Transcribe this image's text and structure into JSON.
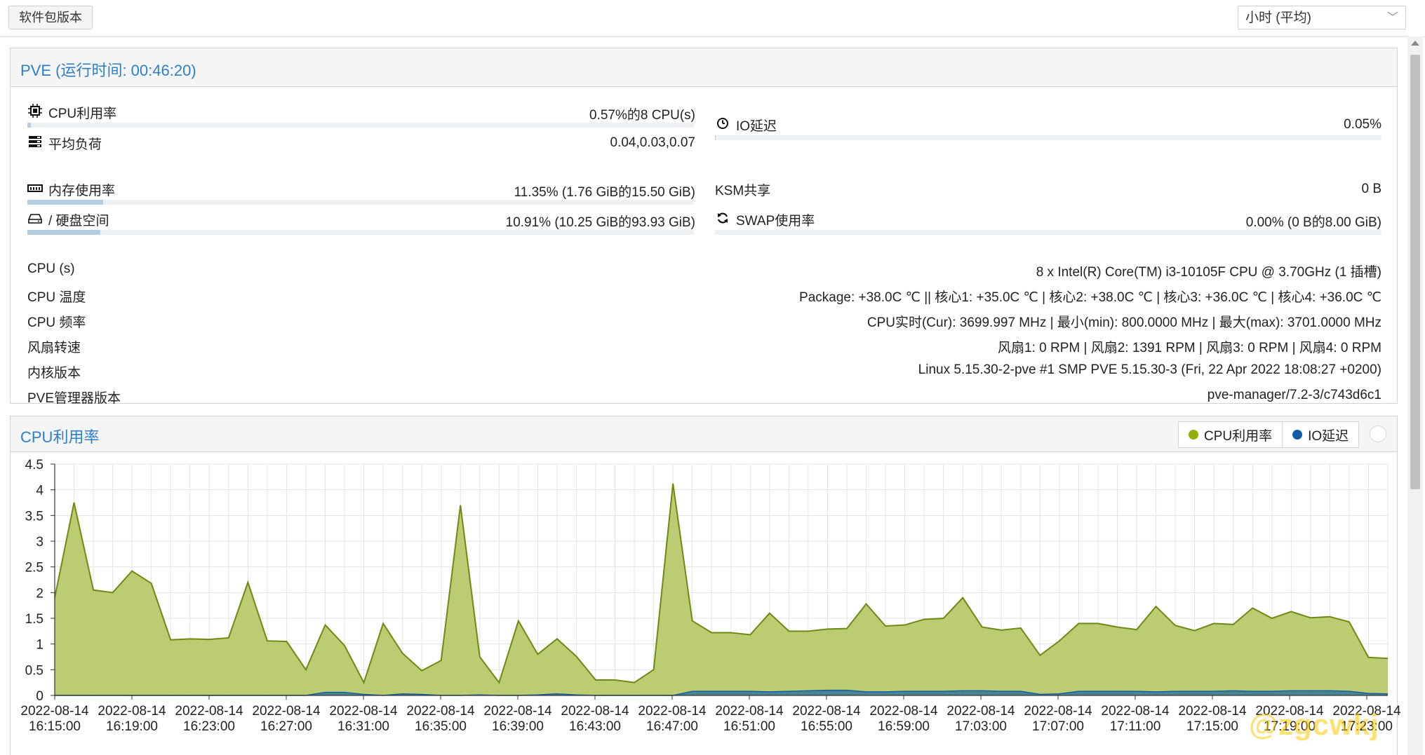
{
  "toolbar": {
    "package_versions_label": "软件包版本",
    "timeframe_value": "小时 (平均)"
  },
  "summary": {
    "title": "PVE (运行时间: 00:46:20)",
    "cpu_usage": {
      "label": "CPU利用率",
      "value": "0.57%的8 CPU(s)",
      "fraction": 0.0057
    },
    "load_avg": {
      "label": "平均负荷",
      "value": "0.04,0.03,0.07"
    },
    "io_delay": {
      "label": "IO延迟",
      "value": "0.05%",
      "fraction": 0.0005
    },
    "memory": {
      "label": "内存使用率",
      "value": "11.35% (1.76 GiB的15.50 GiB)",
      "fraction": 0.1135
    },
    "ksm": {
      "label": "KSM共享",
      "value": "0 B"
    },
    "disk": {
      "label": "/ 硬盘空间",
      "value": "10.91% (10.25 GiB的93.93 GiB)",
      "fraction": 0.1091
    },
    "swap": {
      "label": "SWAP使用率",
      "value": "0.00% (0 B的8.00 GiB)",
      "fraction": 0.0
    },
    "info_rows": [
      {
        "label": "CPU (s)",
        "value": "8 x Intel(R) Core(TM) i3-10105F CPU @ 3.70GHz (1 插槽)"
      },
      {
        "label": "CPU 温度",
        "value": "Package: +38.0C ℃ || 核心1: +35.0C ℃ | 核心2: +38.0C ℃ | 核心3: +36.0C ℃ | 核心4: +36.0C ℃"
      },
      {
        "label": "CPU 频率",
        "value": "CPU实时(Cur): 3699.997 MHz | 最小(min): 800.0000 MHz | 最大(max): 3701.0000 MHz"
      },
      {
        "label": "风扇转速",
        "value": "风扇1: 0 RPM | 风扇2: 1391 RPM | 风扇3: 0 RPM | 风扇4: 0 RPM"
      },
      {
        "label": "内核版本",
        "value": "Linux 5.15.30-2-pve #1 SMP PVE 5.15.30-3 (Fri, 22 Apr 2022 18:08:27 +0200)"
      },
      {
        "label": "PVE管理器版本",
        "value": "pve-manager/7.2-3/c743d6c1"
      }
    ]
  },
  "cpu_chart_panel": {
    "title": "CPU利用率",
    "legend": [
      {
        "name": "CPU利用率",
        "color": "#94ae0a"
      },
      {
        "name": "IO延迟",
        "color": "#115fa6"
      }
    ]
  },
  "chart_data": {
    "type": "area",
    "title": "CPU利用率",
    "ylim": [
      0,
      4.5
    ],
    "yticks": [
      "0",
      "0.5",
      "1",
      "1.5",
      "2",
      "2.5",
      "3",
      "3.5",
      "4",
      "4.5"
    ],
    "x_tick_labels": [
      [
        "2022-08-14",
        "16:15:00"
      ],
      [
        "2022-08-14",
        "16:19:00"
      ],
      [
        "2022-08-14",
        "16:23:00"
      ],
      [
        "2022-08-14",
        "16:27:00"
      ],
      [
        "2022-08-14",
        "16:31:00"
      ],
      [
        "2022-08-14",
        "16:35:00"
      ],
      [
        "2022-08-14",
        "16:39:00"
      ],
      [
        "2022-08-14",
        "16:43:00"
      ],
      [
        "2022-08-14",
        "16:47:00"
      ],
      [
        "2022-08-14",
        "16:51:00"
      ],
      [
        "2022-08-14",
        "16:55:00"
      ],
      [
        "2022-08-14",
        "16:59:00"
      ],
      [
        "2022-08-14",
        "17:03:00"
      ],
      [
        "2022-08-14",
        "17:07:00"
      ],
      [
        "2022-08-14",
        "17:11:00"
      ],
      [
        "2022-08-14",
        "17:15:00"
      ],
      [
        "2022-08-14",
        "17:19:00"
      ],
      [
        "2022-08-14",
        "17:23:00"
      ]
    ],
    "series": [
      {
        "name": "CPU利用率",
        "color": "#94ae0a",
        "values": [
          1.9,
          3.75,
          2.05,
          2.0,
          2.42,
          2.18,
          1.08,
          1.1,
          1.09,
          1.12,
          2.2,
          1.06,
          1.05,
          0.5,
          1.37,
          0.97,
          0.25,
          1.4,
          0.82,
          0.48,
          0.68,
          3.7,
          0.75,
          0.25,
          1.45,
          0.8,
          1.1,
          0.76,
          0.3,
          0.3,
          0.25,
          0.5,
          4.12,
          1.45,
          1.22,
          1.22,
          1.18,
          1.6,
          1.25,
          1.25,
          1.29,
          1.3,
          1.78,
          1.35,
          1.37,
          1.48,
          1.5,
          1.9,
          1.33,
          1.27,
          1.31,
          0.78,
          1.06,
          1.4,
          1.4,
          1.33,
          1.28,
          1.73,
          1.36,
          1.26,
          1.4,
          1.38,
          1.7,
          1.5,
          1.63,
          1.51,
          1.53,
          1.43,
          0.74,
          0.72
        ]
      },
      {
        "name": "IO延迟",
        "color": "#115fa6",
        "values": [
          0,
          0,
          0,
          0,
          0,
          0,
          0,
          0,
          0,
          0,
          0,
          0,
          0,
          0,
          0.06,
          0.06,
          0.02,
          0,
          0.03,
          0.02,
          0,
          0,
          0.01,
          0,
          0,
          0.01,
          0.03,
          0.01,
          0,
          0,
          0,
          0,
          0,
          0.08,
          0.08,
          0.08,
          0.08,
          0.07,
          0.08,
          0.09,
          0.1,
          0.1,
          0.07,
          0.07,
          0.08,
          0.08,
          0.08,
          0.09,
          0.09,
          0.08,
          0.08,
          0.02,
          0.03,
          0.08,
          0.08,
          0.08,
          0.08,
          0.07,
          0.08,
          0.08,
          0.08,
          0.09,
          0.08,
          0.08,
          0.09,
          0.09,
          0.09,
          0.08,
          0.04,
          0.03
        ]
      }
    ],
    "grid": true,
    "legend_position": "top-right"
  }
}
